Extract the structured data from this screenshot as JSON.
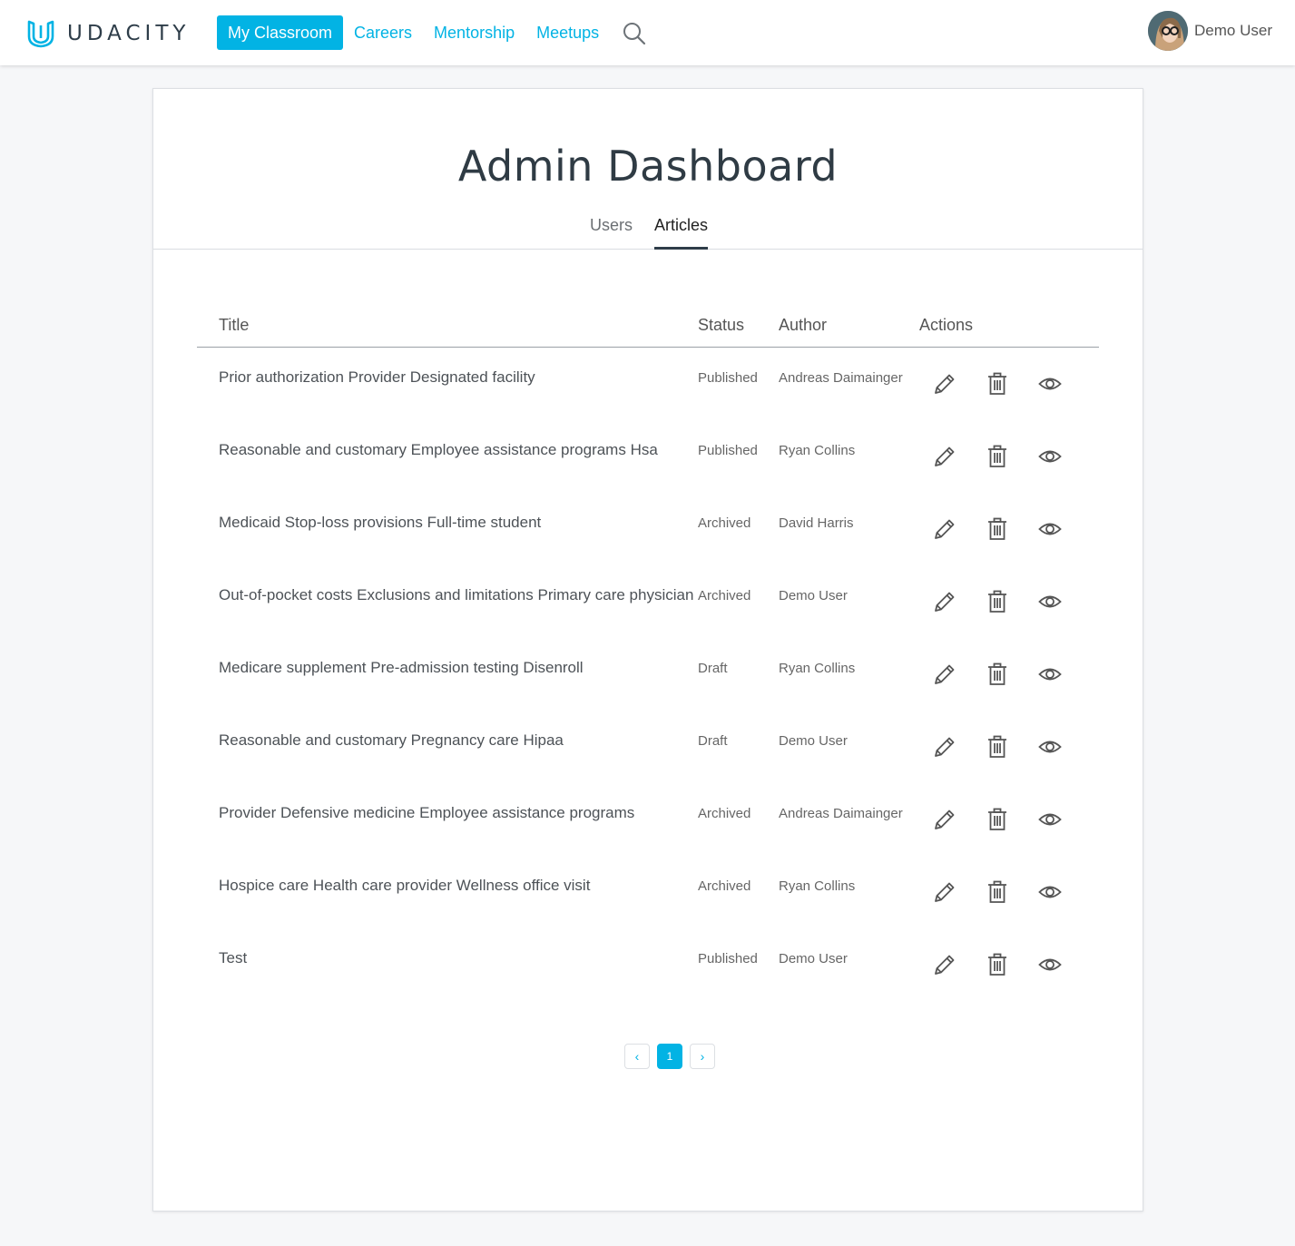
{
  "brand": {
    "name": "UDACITY",
    "color": "#02b3e4"
  },
  "nav": {
    "items": [
      {
        "label": "My Classroom",
        "active": true
      },
      {
        "label": "Careers",
        "active": false
      },
      {
        "label": "Mentorship",
        "active": false
      },
      {
        "label": "Meetups",
        "active": false
      }
    ],
    "search_icon": "search-icon"
  },
  "user": {
    "name": "Demo User"
  },
  "page": {
    "title": "Admin Dashboard",
    "tabs": [
      {
        "label": "Users",
        "active": false
      },
      {
        "label": "Articles",
        "active": true
      }
    ]
  },
  "table": {
    "headers": {
      "title": "Title",
      "status": "Status",
      "author": "Author",
      "actions": "Actions"
    },
    "rows": [
      {
        "title": "Prior authorization Provider Designated facility",
        "status": "Published",
        "author": "Andreas Daimainger"
      },
      {
        "title": "Reasonable and customary Employee assistance programs Hsa",
        "status": "Published",
        "author": "Ryan Collins"
      },
      {
        "title": "Medicaid Stop-loss provisions Full-time student",
        "status": "Archived",
        "author": "David Harris"
      },
      {
        "title": "Out-of-pocket costs Exclusions and limitations Primary care physician",
        "status": "Archived",
        "author": "Demo User"
      },
      {
        "title": "Medicare supplement Pre-admission testing Disenroll",
        "status": "Draft",
        "author": "Ryan Collins"
      },
      {
        "title": "Reasonable and customary Pregnancy care Hipaa",
        "status": "Draft",
        "author": "Demo User"
      },
      {
        "title": "Provider Defensive medicine Employee assistance programs",
        "status": "Archived",
        "author": "Andreas Daimainger"
      },
      {
        "title": "Hospice care Health care provider Wellness office visit",
        "status": "Archived",
        "author": "Ryan Collins"
      },
      {
        "title": "Test",
        "status": "Published",
        "author": "Demo User"
      }
    ],
    "action_icons": [
      "edit-icon",
      "delete-icon",
      "view-icon"
    ]
  },
  "pagination": {
    "prev": "‹",
    "current": "1",
    "next": "›"
  }
}
